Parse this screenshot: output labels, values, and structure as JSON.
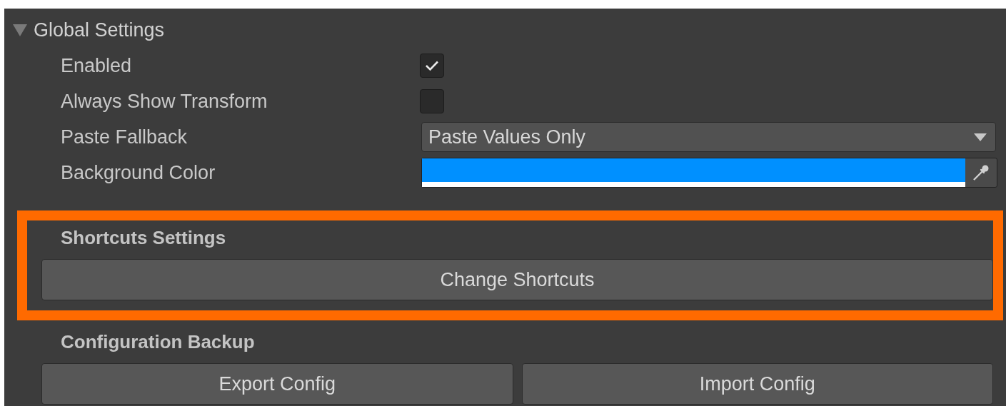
{
  "section": {
    "title": "Global Settings",
    "expanded": true,
    "fields": [
      {
        "kind": "checkbox",
        "label": "Enabled",
        "checked": true
      },
      {
        "kind": "checkbox",
        "label": "Always Show Transform",
        "checked": false
      },
      {
        "kind": "dropdown",
        "label": "Paste Fallback",
        "value": "Paste Values Only"
      },
      {
        "kind": "color",
        "label": "Background Color",
        "color": "#0090ff"
      }
    ]
  },
  "groups": [
    {
      "title": "Shortcuts Settings",
      "highlighted": true,
      "buttons": [
        "Change Shortcuts"
      ]
    },
    {
      "title": "Configuration Backup",
      "highlighted": false,
      "buttons": [
        "Export Config",
        "Import Config"
      ]
    }
  ]
}
